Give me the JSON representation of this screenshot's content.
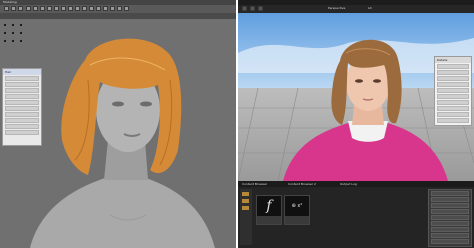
{
  "maya": {
    "menu_label": "Modeling",
    "hair_panel": {
      "header": "Hair",
      "rows": [
        "",
        "",
        "",
        "",
        "",
        "",
        "",
        "",
        "",
        ""
      ]
    }
  },
  "unreal": {
    "toolbar": {
      "mode_label": "Perspective",
      "view_label": "Lit"
    },
    "details_panel": {
      "header": "Details",
      "rows": [
        "",
        "",
        "",
        "",
        "",
        "",
        "",
        "",
        "",
        "",
        ""
      ]
    },
    "content_browser": {
      "tabs": [
        "Content Browser",
        "Content Browser 2",
        "Output Log"
      ],
      "assets": [
        {
          "label": "f",
          "name": ""
        },
        {
          "label": "⊕ x²",
          "name": ""
        }
      ]
    },
    "right_details": {
      "rows": [
        "",
        "",
        "",
        "",
        "",
        "",
        "",
        "",
        "",
        "",
        "",
        "",
        ""
      ]
    }
  },
  "colors": {
    "maya_bg": "#707070",
    "hair": "#d58a37",
    "sky": "#7fb3e8",
    "sweater": "#d8368c"
  },
  "icons": [
    "maya-shelf-icon",
    "unreal-play-icon",
    "folder-icon",
    "function-icon"
  ]
}
